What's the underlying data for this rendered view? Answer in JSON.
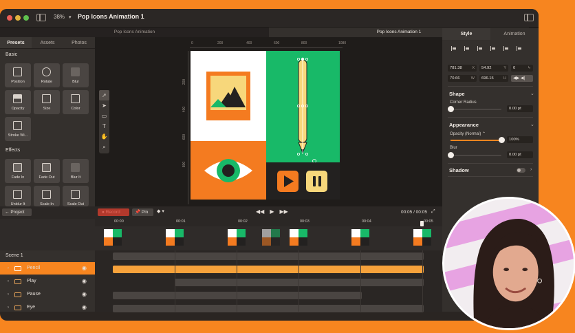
{
  "window": {
    "zoom": "38%",
    "title": "Pop Icons Animation 1",
    "tabs": [
      "Pop Icons Animation",
      "Pop Icons Animation 1"
    ]
  },
  "left_panel": {
    "tabs": [
      "Presets",
      "Assets",
      "Photos"
    ],
    "basic_label": "Basic",
    "basic": [
      "Position",
      "Rotate",
      "Blur",
      "Opacity",
      "Size",
      "Color",
      "Stroke Wi..."
    ],
    "effects_label": "Effects",
    "effects": [
      "Fade In",
      "Fade Out",
      "Blur It",
      "Unblur It",
      "Scale In",
      "Scale Out"
    ]
  },
  "canvas": {
    "ruler_top": [
      "0",
      "200",
      "400",
      "600",
      "800",
      "1080"
    ],
    "ruler_left": [
      "200",
      "400",
      "600",
      "800"
    ],
    "colors": {
      "white": "#ffffff",
      "green": "#18b968",
      "orange": "#f47b20",
      "dark": "#232120",
      "yellow": "#f7d77b"
    }
  },
  "properties": {
    "tabs": [
      "Style",
      "Animation"
    ],
    "x": "781.38",
    "x_label": "X",
    "y": "54.92",
    "y_label": "Y",
    "r": "0",
    "r_label": "↳",
    "w": "70.66",
    "w_label": "W",
    "h": "696.15",
    "h_label": "H",
    "shape_title": "Shape",
    "corner_radius_label": "Corner Radius",
    "corner_radius_value": "0.00 pt",
    "appearance_title": "Appearance",
    "opacity_label": "Opacity (Normal) ⌃",
    "opacity_value": "100%",
    "opacity_level": 1.0,
    "blur_label": "Blur",
    "blur_value": "0.00 pt",
    "shadow_title": "Shadow"
  },
  "timeline": {
    "project_button": "Project",
    "record_button": "Record",
    "pin_button": "Pin",
    "timecode": "00:05 / 00:05",
    "ruler": [
      "00:00",
      "00:01",
      "00:02",
      "00:03",
      "00:04",
      "00:05"
    ],
    "scene": "Scene 1",
    "layers": [
      "Pencil",
      "Play",
      "Pause",
      "Eye"
    ]
  }
}
